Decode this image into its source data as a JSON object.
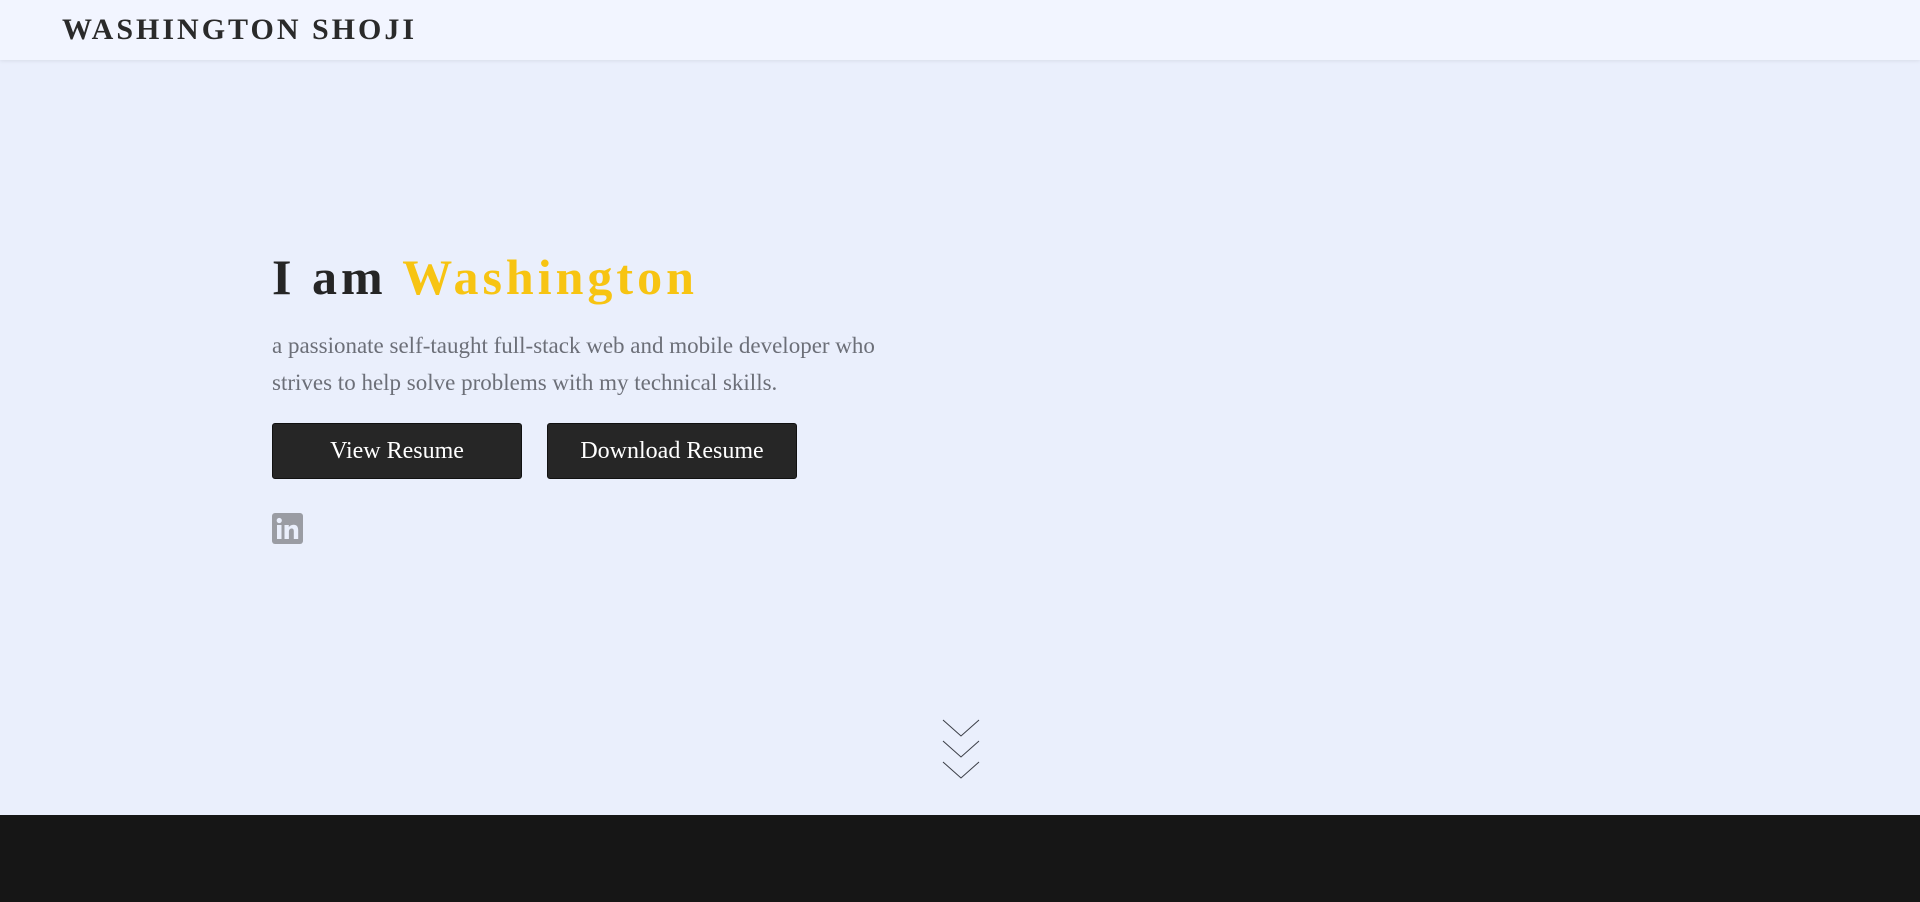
{
  "navbar": {
    "brand": "WASHINGTON SHOJI"
  },
  "hero": {
    "headline_prefix": "I am",
    "headline_name": "Washington",
    "tagline": "a passionate self-taught full-stack web and mobile developer who strives to help solve problems with my technical skills.",
    "buttons": {
      "view_resume": "View Resume",
      "download_resume": "Download Resume"
    },
    "social": [
      {
        "icon": "linkedin-icon"
      }
    ],
    "scroll_icon": "chevrons-down-icon"
  },
  "colors": {
    "background": "#eaeffc",
    "navbar": "#f2f5ff",
    "accent": "#f7c412",
    "button": "#262626",
    "text_dark": "#252525",
    "text_muted": "#6c6f78",
    "footer": "#161616",
    "icon_gray": "#9a9ca3"
  }
}
